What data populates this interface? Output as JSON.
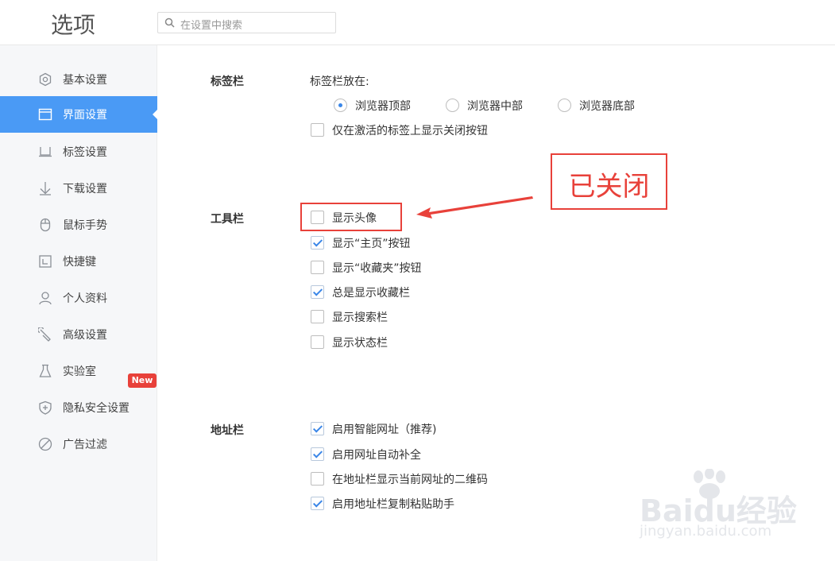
{
  "header": {
    "title": "选项",
    "search_placeholder": "在设置中搜索"
  },
  "sidebar": {
    "items": [
      {
        "label": "基本设置",
        "icon": "hexagon-gear-icon"
      },
      {
        "label": "界面设置",
        "icon": "window-icon",
        "active": true
      },
      {
        "label": "标签设置",
        "icon": "tab-icon"
      },
      {
        "label": "下载设置",
        "icon": "download-arrow-icon"
      },
      {
        "label": "鼠标手势",
        "icon": "mouse-icon"
      },
      {
        "label": "快捷键",
        "icon": "shortcut-key-icon"
      },
      {
        "label": "个人资料",
        "icon": "person-icon"
      },
      {
        "label": "高级设置",
        "icon": "wrench-icon"
      },
      {
        "label": "实验室",
        "icon": "flask-icon"
      },
      {
        "label": "隐私安全设置",
        "icon": "shield-plus-icon"
      },
      {
        "label": "广告过滤",
        "icon": "block-circle-icon"
      }
    ],
    "new_badge": "New"
  },
  "tabbar_section": {
    "title": "标签栏",
    "position_label": "标签栏放在:",
    "options": [
      {
        "label": "浏览器顶部",
        "checked": true
      },
      {
        "label": "浏览器中部",
        "checked": false
      },
      {
        "label": "浏览器底部",
        "checked": false
      }
    ],
    "close_button_option": {
      "label": "仅在激活的标签上显示关闭按钮",
      "checked": false
    }
  },
  "toolbar_section": {
    "title": "工具栏",
    "options": [
      {
        "label": "显示头像",
        "checked": false
      },
      {
        "label": "显示“主页”按钮",
        "checked": true
      },
      {
        "label": "显示“收藏夹”按钮",
        "checked": false
      },
      {
        "label": "总是显示收藏栏",
        "checked": true
      },
      {
        "label": "显示搜索栏",
        "checked": false
      },
      {
        "label": "显示状态栏",
        "checked": false
      }
    ]
  },
  "addressbar_section": {
    "title": "地址栏",
    "options": [
      {
        "label": "启用智能网址（推荐)",
        "checked": true
      },
      {
        "label": "启用网址自动补全",
        "checked": true
      },
      {
        "label": "在地址栏显示当前网址的二维码",
        "checked": false
      },
      {
        "label": "启用地址栏复制粘贴助手",
        "checked": true
      }
    ]
  },
  "annotation": {
    "label": "已关闭",
    "color": "#e8413a"
  },
  "watermark": {
    "line1": "Baidu经验",
    "line2": "jingyan.baidu.com"
  },
  "colors": {
    "accent": "#4a9af5",
    "check": "#3a86e8",
    "badge": "#e8413a"
  }
}
